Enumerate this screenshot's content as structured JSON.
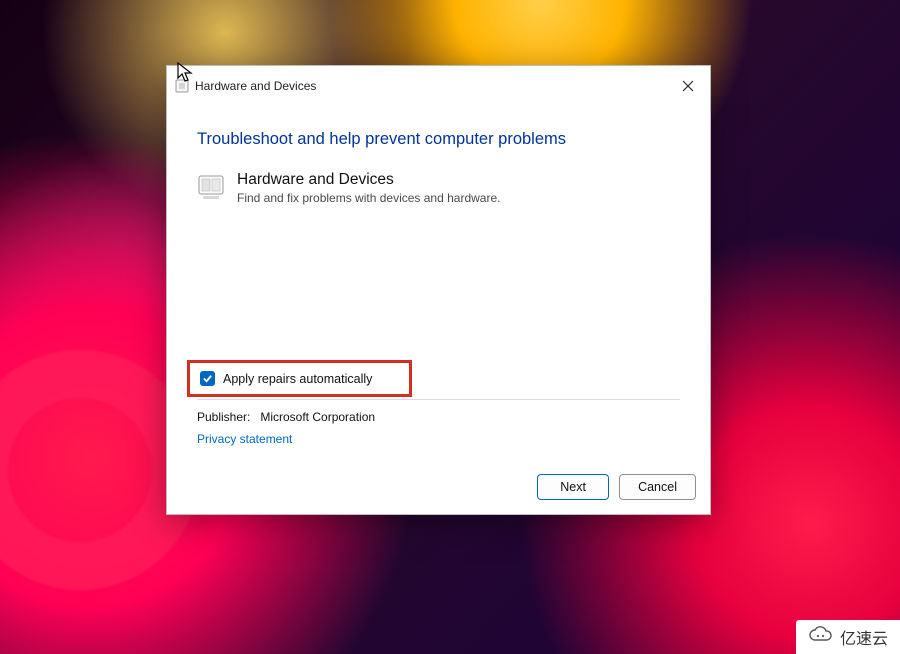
{
  "window": {
    "title": "Hardware and Devices"
  },
  "heading": "Troubleshoot and help prevent computer problems",
  "category": {
    "title": "Hardware and Devices",
    "desc": "Find and fix problems with devices and hardware."
  },
  "checkbox": {
    "label": "Apply repairs automatically",
    "checked": true
  },
  "publisher": {
    "label": "Publisher:",
    "value": "Microsoft Corporation"
  },
  "privacy_link": "Privacy statement",
  "buttons": {
    "next": "Next",
    "cancel": "Cancel"
  },
  "watermark": "亿速云",
  "icons": {
    "close": "close-icon",
    "hardware_small": "hardware-small-icon",
    "hardware_large": "hardware-large-icon",
    "checkbox_check": "check-icon",
    "cursor": "cursor-icon",
    "cloud": "cloud-icon"
  },
  "colors": {
    "link": "#0067c0",
    "heading": "#003399",
    "highlight_border": "#d22e21",
    "checkbox_bg": "#0067c0"
  }
}
